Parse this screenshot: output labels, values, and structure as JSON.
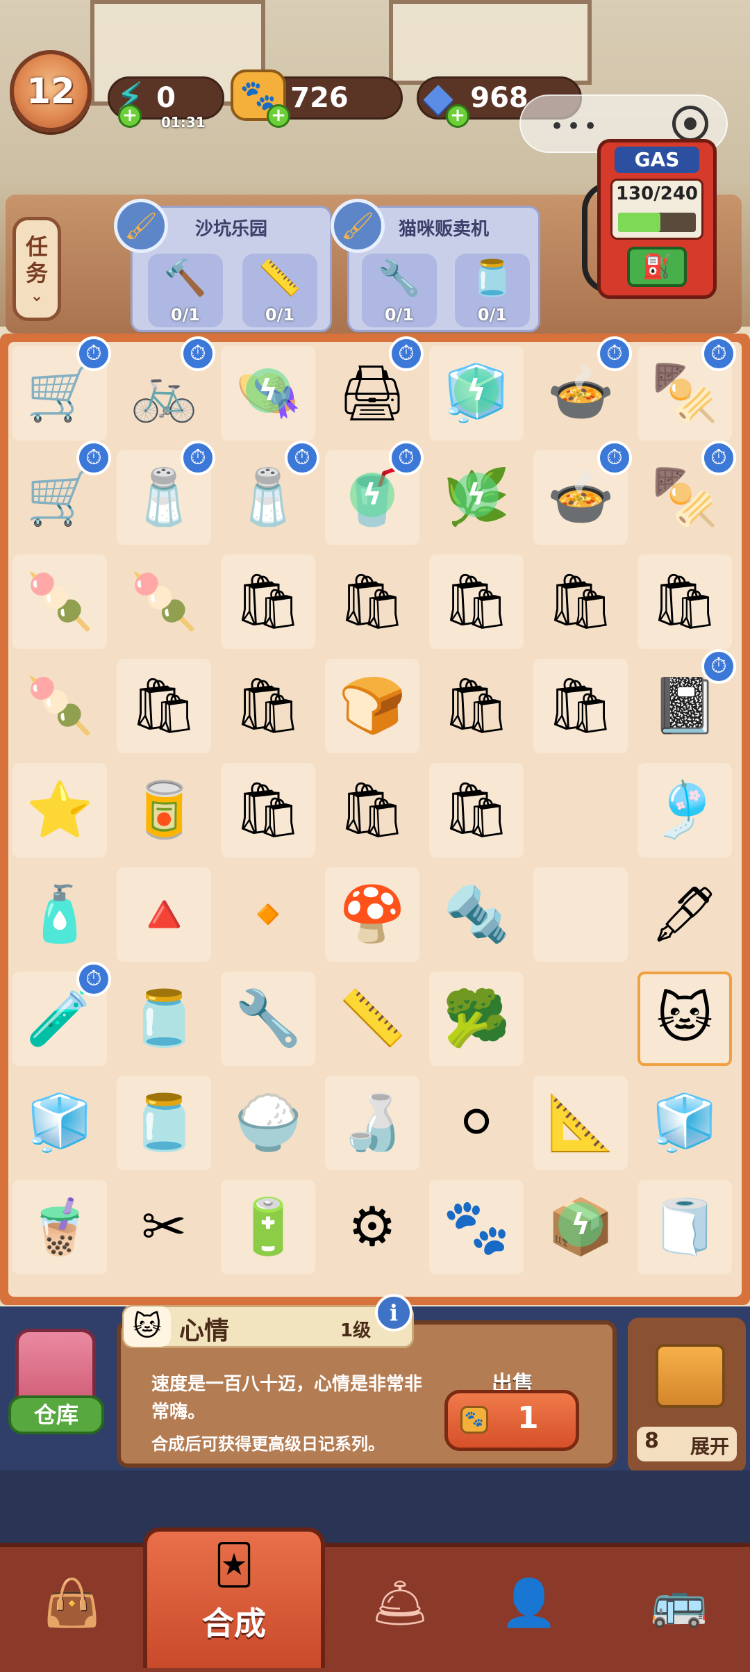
{
  "player": {
    "level": "12"
  },
  "resources": {
    "energy": {
      "value": "0",
      "timer": "01:31"
    },
    "coins": {
      "value": "726"
    },
    "gems": {
      "value": "968"
    }
  },
  "task_button": {
    "label_line1": "任",
    "label_line2": "务"
  },
  "quests": [
    {
      "title": "沙坑乐园",
      "requirements": [
        {
          "icon": "hammer-icon",
          "count": "0/1"
        },
        {
          "icon": "tape-measure-icon",
          "count": "0/1"
        }
      ]
    },
    {
      "title": "猫咪贩卖机",
      "requirements": [
        {
          "icon": "pliers-icon",
          "count": "0/1"
        },
        {
          "icon": "jar-icon",
          "count": "0/1"
        }
      ]
    }
  ],
  "gas": {
    "label": "GAS",
    "value": "130/240",
    "current": 130,
    "max": 240
  },
  "board": {
    "rows": [
      [
        {
          "icon": "hand-truck",
          "g": "🛒",
          "lock": true
        },
        {
          "icon": "delivery-bike",
          "g": "🚲",
          "lock": true
        },
        {
          "icon": "chef-hat",
          "g": "👒",
          "bolt": true
        },
        {
          "icon": "printer",
          "g": "🖨",
          "lock": true
        },
        {
          "icon": "glass-case",
          "g": "🧊",
          "bolt": true
        },
        {
          "icon": "curry-pot",
          "g": "🍲",
          "lock": true
        },
        {
          "icon": "skewer-pot",
          "g": "🍢",
          "lock": true
        }
      ],
      [
        {
          "icon": "hand-truck",
          "g": "🛒",
          "lock": true
        },
        {
          "icon": "condiment-rack",
          "g": "🧂",
          "lock": true
        },
        {
          "icon": "condiment-rack",
          "g": "🧂",
          "lock": true
        },
        {
          "icon": "tumbler",
          "g": "🥤",
          "bolt": true,
          "lock": true
        },
        {
          "icon": "plant",
          "g": "🌿",
          "bolt": true
        },
        {
          "icon": "curry-pot",
          "g": "🍲",
          "lock": true
        },
        {
          "icon": "skewer-pot",
          "g": "🍢",
          "lock": true
        }
      ],
      [
        {
          "icon": "skewer-cards",
          "g": "🍡"
        },
        {
          "icon": "skewer-cards",
          "g": "🍡"
        },
        {
          "icon": "paper-bag",
          "g": "🛍"
        },
        {
          "icon": "paper-bag",
          "g": "🛍"
        },
        {
          "icon": "paper-bag",
          "g": "🛍"
        },
        {
          "icon": "paper-bag",
          "g": "🛍"
        },
        {
          "icon": "paper-bag",
          "g": "🛍"
        }
      ],
      [
        {
          "icon": "skewer-cards",
          "g": "🍡"
        },
        {
          "icon": "paper-bag",
          "g": "🛍"
        },
        {
          "icon": "paper-bag",
          "g": "🛍"
        },
        {
          "icon": "toast",
          "g": "🍞"
        },
        {
          "icon": "paper-bag",
          "g": "🛍"
        },
        {
          "icon": "paper-bag",
          "g": "🛍"
        },
        {
          "icon": "notebook",
          "g": "📓",
          "lock": true
        }
      ],
      [
        {
          "icon": "star",
          "g": "⭐"
        },
        {
          "icon": "ketchup",
          "g": "🥫"
        },
        {
          "icon": "paper-bag",
          "g": "🛍"
        },
        {
          "icon": "paper-bag-open",
          "g": "🛍"
        },
        {
          "icon": "paper-bag-open",
          "g": "🛍"
        },
        {
          "icon": "empty",
          "g": ""
        },
        {
          "icon": "ghost-doll",
          "g": "🎐"
        }
      ],
      [
        {
          "icon": "sauce-bottle",
          "g": "🧴"
        },
        {
          "icon": "gem-shard",
          "g": "🔺"
        },
        {
          "icon": "gem-shard",
          "g": "🔸"
        },
        {
          "icon": "mushroom",
          "g": "🍄"
        },
        {
          "icon": "screw",
          "g": "🔩"
        },
        {
          "icon": "empty",
          "g": ""
        },
        {
          "icon": "fountain-pen",
          "g": "🖋"
        }
      ],
      [
        {
          "icon": "ink-bottle",
          "g": "🧪",
          "lock": true
        },
        {
          "icon": "chili-jar",
          "g": "🫙"
        },
        {
          "icon": "wrench",
          "g": "🔧"
        },
        {
          "icon": "tape-measure",
          "g": "📏"
        },
        {
          "icon": "broccoli",
          "g": "🥦"
        },
        {
          "icon": "empty",
          "g": ""
        },
        {
          "icon": "cat",
          "g": "🐱",
          "selected": true
        }
      ],
      [
        {
          "icon": "sugar-cube",
          "g": "🧊"
        },
        {
          "icon": "ink-bottle",
          "g": "🫙"
        },
        {
          "icon": "rice-tray",
          "g": "🍚"
        },
        {
          "icon": "soy-sauce",
          "g": "🍶"
        },
        {
          "icon": "ball",
          "g": "⚪"
        },
        {
          "icon": "ruler",
          "g": "📐"
        },
        {
          "icon": "sugar-cubes",
          "g": "🧊"
        }
      ],
      [
        {
          "icon": "bubble-tea",
          "g": "🧋"
        },
        {
          "icon": "scissors",
          "g": "✂"
        },
        {
          "icon": "pipe",
          "g": "🔋"
        },
        {
          "icon": "gear",
          "g": "⚙"
        },
        {
          "icon": "cat-paw",
          "g": "🐾"
        },
        {
          "icon": "metal-box",
          "g": "📦",
          "bolt": true
        },
        {
          "icon": "towel",
          "g": "🧻"
        }
      ]
    ]
  },
  "info": {
    "name": "心情",
    "level": "1级",
    "description": "速度是一百八十迈，心情是非常非常嗨。",
    "hint": "合成后可获得更高级日记系列。"
  },
  "sell": {
    "label": "出售",
    "value": "1"
  },
  "warehouse": {
    "label": "仓库"
  },
  "expand": {
    "count": "8",
    "label": "展开"
  },
  "nav": {
    "merge_label": "合成"
  }
}
